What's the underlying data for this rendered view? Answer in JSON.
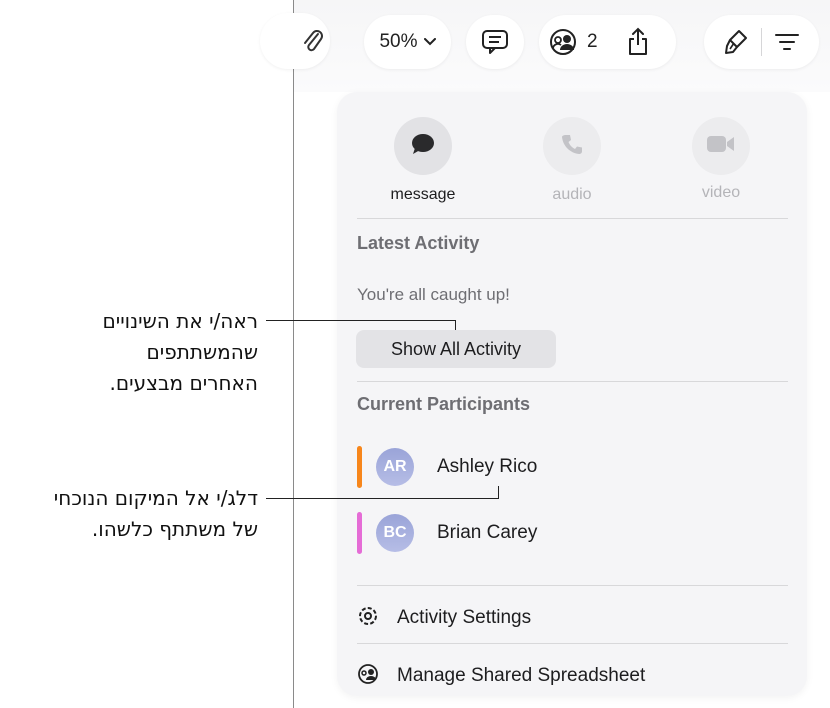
{
  "toolbar": {
    "zoom_label": "50%",
    "collab_count": "2"
  },
  "popover": {
    "message_label": "message",
    "audio_label": "audio",
    "video_label": "video",
    "latest_activity_title": "Latest Activity",
    "caught_up_text": "You're all caught up!",
    "show_all_label": "Show All Activity",
    "participants_title": "Current Participants",
    "participants": [
      {
        "initials": "AR",
        "name": "Ashley Rico",
        "color": "#f7861b"
      },
      {
        "initials": "BC",
        "name": "Brian Carey",
        "color": "#e56cd6"
      }
    ],
    "activity_settings_label": "Activity Settings",
    "manage_shared_label": "Manage Shared Spreadsheet"
  },
  "callouts": {
    "see_changes": [
      "ראה/י את השינויים",
      "שהמשתתפים",
      "האחרים מבצעים."
    ],
    "jump_location": [
      "דלג/י אל המיקום הנוכחי",
      "של משתתף כלשהו."
    ]
  }
}
